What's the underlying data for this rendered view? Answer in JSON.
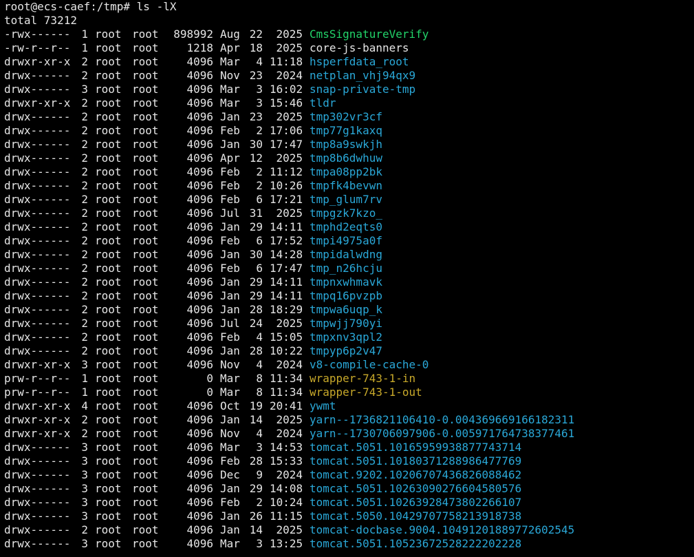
{
  "terminal": {
    "prompt": "root@ecs-caef:/tmp#",
    "command": "ls -lX",
    "total": "total 73212",
    "colors": {
      "background": "#000000",
      "text": "#e6e6e6",
      "dir": "#2aa8d8",
      "exec": "#22d36a",
      "pipe": "#c8a92a"
    },
    "entries": [
      {
        "perms": "-rwx------",
        "links": "1",
        "owner": "root",
        "group": "root",
        "size": "898992",
        "month": "Aug",
        "day": "22",
        "time": "2025",
        "name": "CmsSignatureVerify",
        "type": "exec"
      },
      {
        "perms": "-rw-r--r--",
        "links": "1",
        "owner": "root",
        "group": "root",
        "size": "1218",
        "month": "Apr",
        "day": "18",
        "time": "2025",
        "name": "core-js-banners",
        "type": "file"
      },
      {
        "perms": "drwxr-xr-x",
        "links": "2",
        "owner": "root",
        "group": "root",
        "size": "4096",
        "month": "Mar",
        "day": "4",
        "time": "11:18",
        "name": "hsperfdata_root",
        "type": "dir"
      },
      {
        "perms": "drwx------",
        "links": "2",
        "owner": "root",
        "group": "root",
        "size": "4096",
        "month": "Nov",
        "day": "23",
        "time": "2024",
        "name": "netplan_vhj94qx9",
        "type": "dir"
      },
      {
        "perms": "drwx------",
        "links": "3",
        "owner": "root",
        "group": "root",
        "size": "4096",
        "month": "Mar",
        "day": "3",
        "time": "16:02",
        "name": "snap-private-tmp",
        "type": "dir"
      },
      {
        "perms": "drwxr-xr-x",
        "links": "2",
        "owner": "root",
        "group": "root",
        "size": "4096",
        "month": "Mar",
        "day": "3",
        "time": "15:46",
        "name": "tldr",
        "type": "dir"
      },
      {
        "perms": "drwx------",
        "links": "2",
        "owner": "root",
        "group": "root",
        "size": "4096",
        "month": "Jan",
        "day": "23",
        "time": "2025",
        "name": "tmp302vr3cf",
        "type": "dir"
      },
      {
        "perms": "drwx------",
        "links": "2",
        "owner": "root",
        "group": "root",
        "size": "4096",
        "month": "Feb",
        "day": "2",
        "time": "17:06",
        "name": "tmp77g1kaxq",
        "type": "dir"
      },
      {
        "perms": "drwx------",
        "links": "2",
        "owner": "root",
        "group": "root",
        "size": "4096",
        "month": "Jan",
        "day": "30",
        "time": "17:47",
        "name": "tmp8a9swkjh",
        "type": "dir"
      },
      {
        "perms": "drwx------",
        "links": "2",
        "owner": "root",
        "group": "root",
        "size": "4096",
        "month": "Apr",
        "day": "12",
        "time": "2025",
        "name": "tmp8b6dwhuw",
        "type": "dir"
      },
      {
        "perms": "drwx------",
        "links": "2",
        "owner": "root",
        "group": "root",
        "size": "4096",
        "month": "Feb",
        "day": "2",
        "time": "11:12",
        "name": "tmpa08pp2bk",
        "type": "dir"
      },
      {
        "perms": "drwx------",
        "links": "2",
        "owner": "root",
        "group": "root",
        "size": "4096",
        "month": "Feb",
        "day": "2",
        "time": "10:26",
        "name": "tmpfk4bevwn",
        "type": "dir"
      },
      {
        "perms": "drwx------",
        "links": "2",
        "owner": "root",
        "group": "root",
        "size": "4096",
        "month": "Feb",
        "day": "6",
        "time": "17:21",
        "name": "tmp_glum7rv",
        "type": "dir"
      },
      {
        "perms": "drwx------",
        "links": "2",
        "owner": "root",
        "group": "root",
        "size": "4096",
        "month": "Jul",
        "day": "31",
        "time": "2025",
        "name": "tmpgzk7kzo_",
        "type": "dir"
      },
      {
        "perms": "drwx------",
        "links": "2",
        "owner": "root",
        "group": "root",
        "size": "4096",
        "month": "Jan",
        "day": "29",
        "time": "14:11",
        "name": "tmphd2eqts0",
        "type": "dir"
      },
      {
        "perms": "drwx------",
        "links": "2",
        "owner": "root",
        "group": "root",
        "size": "4096",
        "month": "Feb",
        "day": "6",
        "time": "17:52",
        "name": "tmpi4975a0f",
        "type": "dir"
      },
      {
        "perms": "drwx------",
        "links": "2",
        "owner": "root",
        "group": "root",
        "size": "4096",
        "month": "Jan",
        "day": "30",
        "time": "14:28",
        "name": "tmpidalwdng",
        "type": "dir"
      },
      {
        "perms": "drwx------",
        "links": "2",
        "owner": "root",
        "group": "root",
        "size": "4096",
        "month": "Feb",
        "day": "6",
        "time": "17:47",
        "name": "tmp_n26hcju",
        "type": "dir"
      },
      {
        "perms": "drwx------",
        "links": "2",
        "owner": "root",
        "group": "root",
        "size": "4096",
        "month": "Jan",
        "day": "29",
        "time": "14:11",
        "name": "tmpnxwhmavk",
        "type": "dir"
      },
      {
        "perms": "drwx------",
        "links": "2",
        "owner": "root",
        "group": "root",
        "size": "4096",
        "month": "Jan",
        "day": "29",
        "time": "14:11",
        "name": "tmpq16pvzpb",
        "type": "dir"
      },
      {
        "perms": "drwx------",
        "links": "2",
        "owner": "root",
        "group": "root",
        "size": "4096",
        "month": "Jan",
        "day": "28",
        "time": "18:29",
        "name": "tmpwa6uqp_k",
        "type": "dir"
      },
      {
        "perms": "drwx------",
        "links": "2",
        "owner": "root",
        "group": "root",
        "size": "4096",
        "month": "Jul",
        "day": "24",
        "time": "2025",
        "name": "tmpwjj790yi",
        "type": "dir"
      },
      {
        "perms": "drwx------",
        "links": "2",
        "owner": "root",
        "group": "root",
        "size": "4096",
        "month": "Feb",
        "day": "4",
        "time": "15:05",
        "name": "tmpxnv3qpl2",
        "type": "dir"
      },
      {
        "perms": "drwx------",
        "links": "2",
        "owner": "root",
        "group": "root",
        "size": "4096",
        "month": "Jan",
        "day": "28",
        "time": "10:22",
        "name": "tmpyp6p2v47",
        "type": "dir"
      },
      {
        "perms": "drwxr-xr-x",
        "links": "3",
        "owner": "root",
        "group": "root",
        "size": "4096",
        "month": "Nov",
        "day": "4",
        "time": "2024",
        "name": "v8-compile-cache-0",
        "type": "dir"
      },
      {
        "perms": "prw-r--r--",
        "links": "1",
        "owner": "root",
        "group": "root",
        "size": "0",
        "month": "Mar",
        "day": "8",
        "time": "11:34",
        "name": "wrapper-743-1-in",
        "type": "pipe"
      },
      {
        "perms": "prw-r--r--",
        "links": "1",
        "owner": "root",
        "group": "root",
        "size": "0",
        "month": "Mar",
        "day": "8",
        "time": "11:34",
        "name": "wrapper-743-1-out",
        "type": "pipe"
      },
      {
        "perms": "drwxr-xr-x",
        "links": "4",
        "owner": "root",
        "group": "root",
        "size": "4096",
        "month": "Oct",
        "day": "19",
        "time": "20:41",
        "name": "ywmt",
        "type": "dir"
      },
      {
        "perms": "drwxr-xr-x",
        "links": "2",
        "owner": "root",
        "group": "root",
        "size": "4096",
        "month": "Jan",
        "day": "14",
        "time": "2025",
        "name": "yarn--1736821106410-0.004369669166182311",
        "type": "dir"
      },
      {
        "perms": "drwxr-xr-x",
        "links": "2",
        "owner": "root",
        "group": "root",
        "size": "4096",
        "month": "Nov",
        "day": "4",
        "time": "2024",
        "name": "yarn--1730706097906-0.005971764738377461",
        "type": "dir"
      },
      {
        "perms": "drwx------",
        "links": "3",
        "owner": "root",
        "group": "root",
        "size": "4096",
        "month": "Mar",
        "day": "3",
        "time": "14:53",
        "name": "tomcat.5051.10165959938877743714",
        "type": "dir"
      },
      {
        "perms": "drwx------",
        "links": "3",
        "owner": "root",
        "group": "root",
        "size": "4096",
        "month": "Feb",
        "day": "28",
        "time": "15:33",
        "name": "tomcat.5051.10180371288986477769",
        "type": "dir"
      },
      {
        "perms": "drwx------",
        "links": "3",
        "owner": "root",
        "group": "root",
        "size": "4096",
        "month": "Dec",
        "day": "9",
        "time": "2024",
        "name": "tomcat.9202.10206707436826088462",
        "type": "dir"
      },
      {
        "perms": "drwx------",
        "links": "3",
        "owner": "root",
        "group": "root",
        "size": "4096",
        "month": "Jan",
        "day": "29",
        "time": "14:08",
        "name": "tomcat.5051.10263090276604580576",
        "type": "dir"
      },
      {
        "perms": "drwx------",
        "links": "3",
        "owner": "root",
        "group": "root",
        "size": "4096",
        "month": "Feb",
        "day": "2",
        "time": "10:24",
        "name": "tomcat.5051.10263928473802266107",
        "type": "dir"
      },
      {
        "perms": "drwx------",
        "links": "3",
        "owner": "root",
        "group": "root",
        "size": "4096",
        "month": "Jan",
        "day": "26",
        "time": "11:15",
        "name": "tomcat.5050.10429707758213918738",
        "type": "dir"
      },
      {
        "perms": "drwx------",
        "links": "2",
        "owner": "root",
        "group": "root",
        "size": "4096",
        "month": "Jan",
        "day": "14",
        "time": "2025",
        "name": "tomcat-docbase.9004.10491201889772602545",
        "type": "dir"
      },
      {
        "perms": "drwx------",
        "links": "3",
        "owner": "root",
        "group": "root",
        "size": "4096",
        "month": "Mar",
        "day": "3",
        "time": "13:25",
        "name": "tomcat.5051.10523672528222202228",
        "type": "dir"
      }
    ]
  }
}
